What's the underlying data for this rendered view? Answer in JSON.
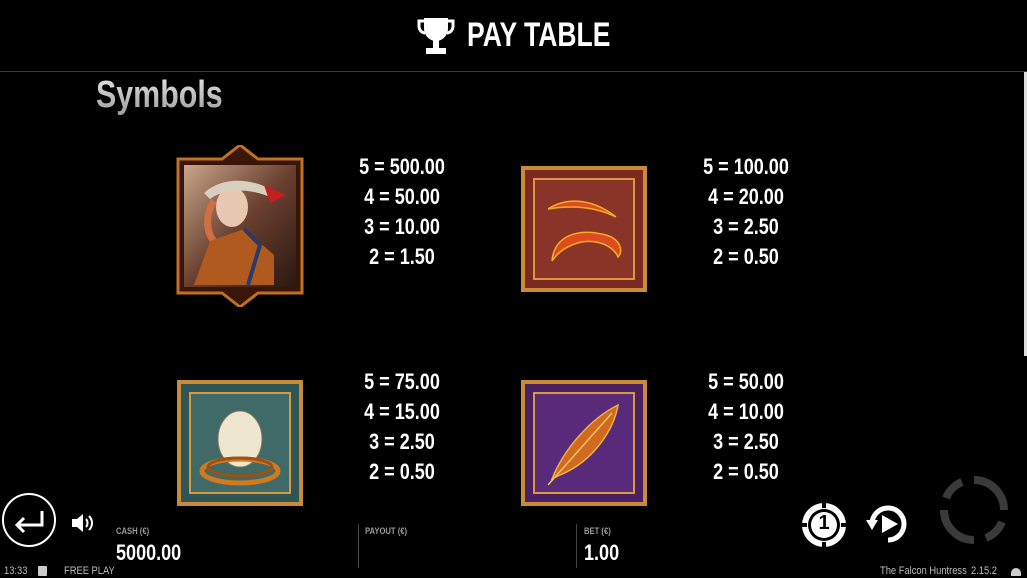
{
  "header": {
    "title": "PAY TABLE",
    "icon": "trophy-icon"
  },
  "section_title": "Symbols",
  "symbols": [
    {
      "name": "huntress",
      "pays": [
        "5 = 500.00",
        "4 = 50.00",
        "3 = 10.00",
        "2 = 1.50"
      ]
    },
    {
      "name": "red-feathers",
      "pays": [
        "5 = 100.00",
        "4 = 20.00",
        "3 = 2.50",
        "2 = 0.50"
      ]
    },
    {
      "name": "egg-nest",
      "pays": [
        "5 = 75.00",
        "4 = 15.00",
        "3 = 2.50",
        "2 = 0.50"
      ]
    },
    {
      "name": "orange-feather",
      "pays": [
        "5 = 50.00",
        "4 = 10.00",
        "3 = 2.50",
        "2 = 0.50"
      ]
    }
  ],
  "bottom_bar": {
    "cash_label": "CASH (€)",
    "cash_value": "5000.00",
    "payout_label": "PAYOUT (€)",
    "payout_value": "",
    "bet_label": "BET (€)",
    "bet_value": "1.00",
    "bet_level": "1"
  },
  "footer": {
    "time": "13:33",
    "mode": "FREE PLAY",
    "game_name": "The Falcon Huntress",
    "version": "2.15.2"
  },
  "colors": {
    "background": "#000000",
    "frame_gold": "#d08a2a",
    "red_tile": "#8a2a22",
    "teal_tile": "#3f6a68",
    "purple_tile": "#5a2a7a"
  }
}
